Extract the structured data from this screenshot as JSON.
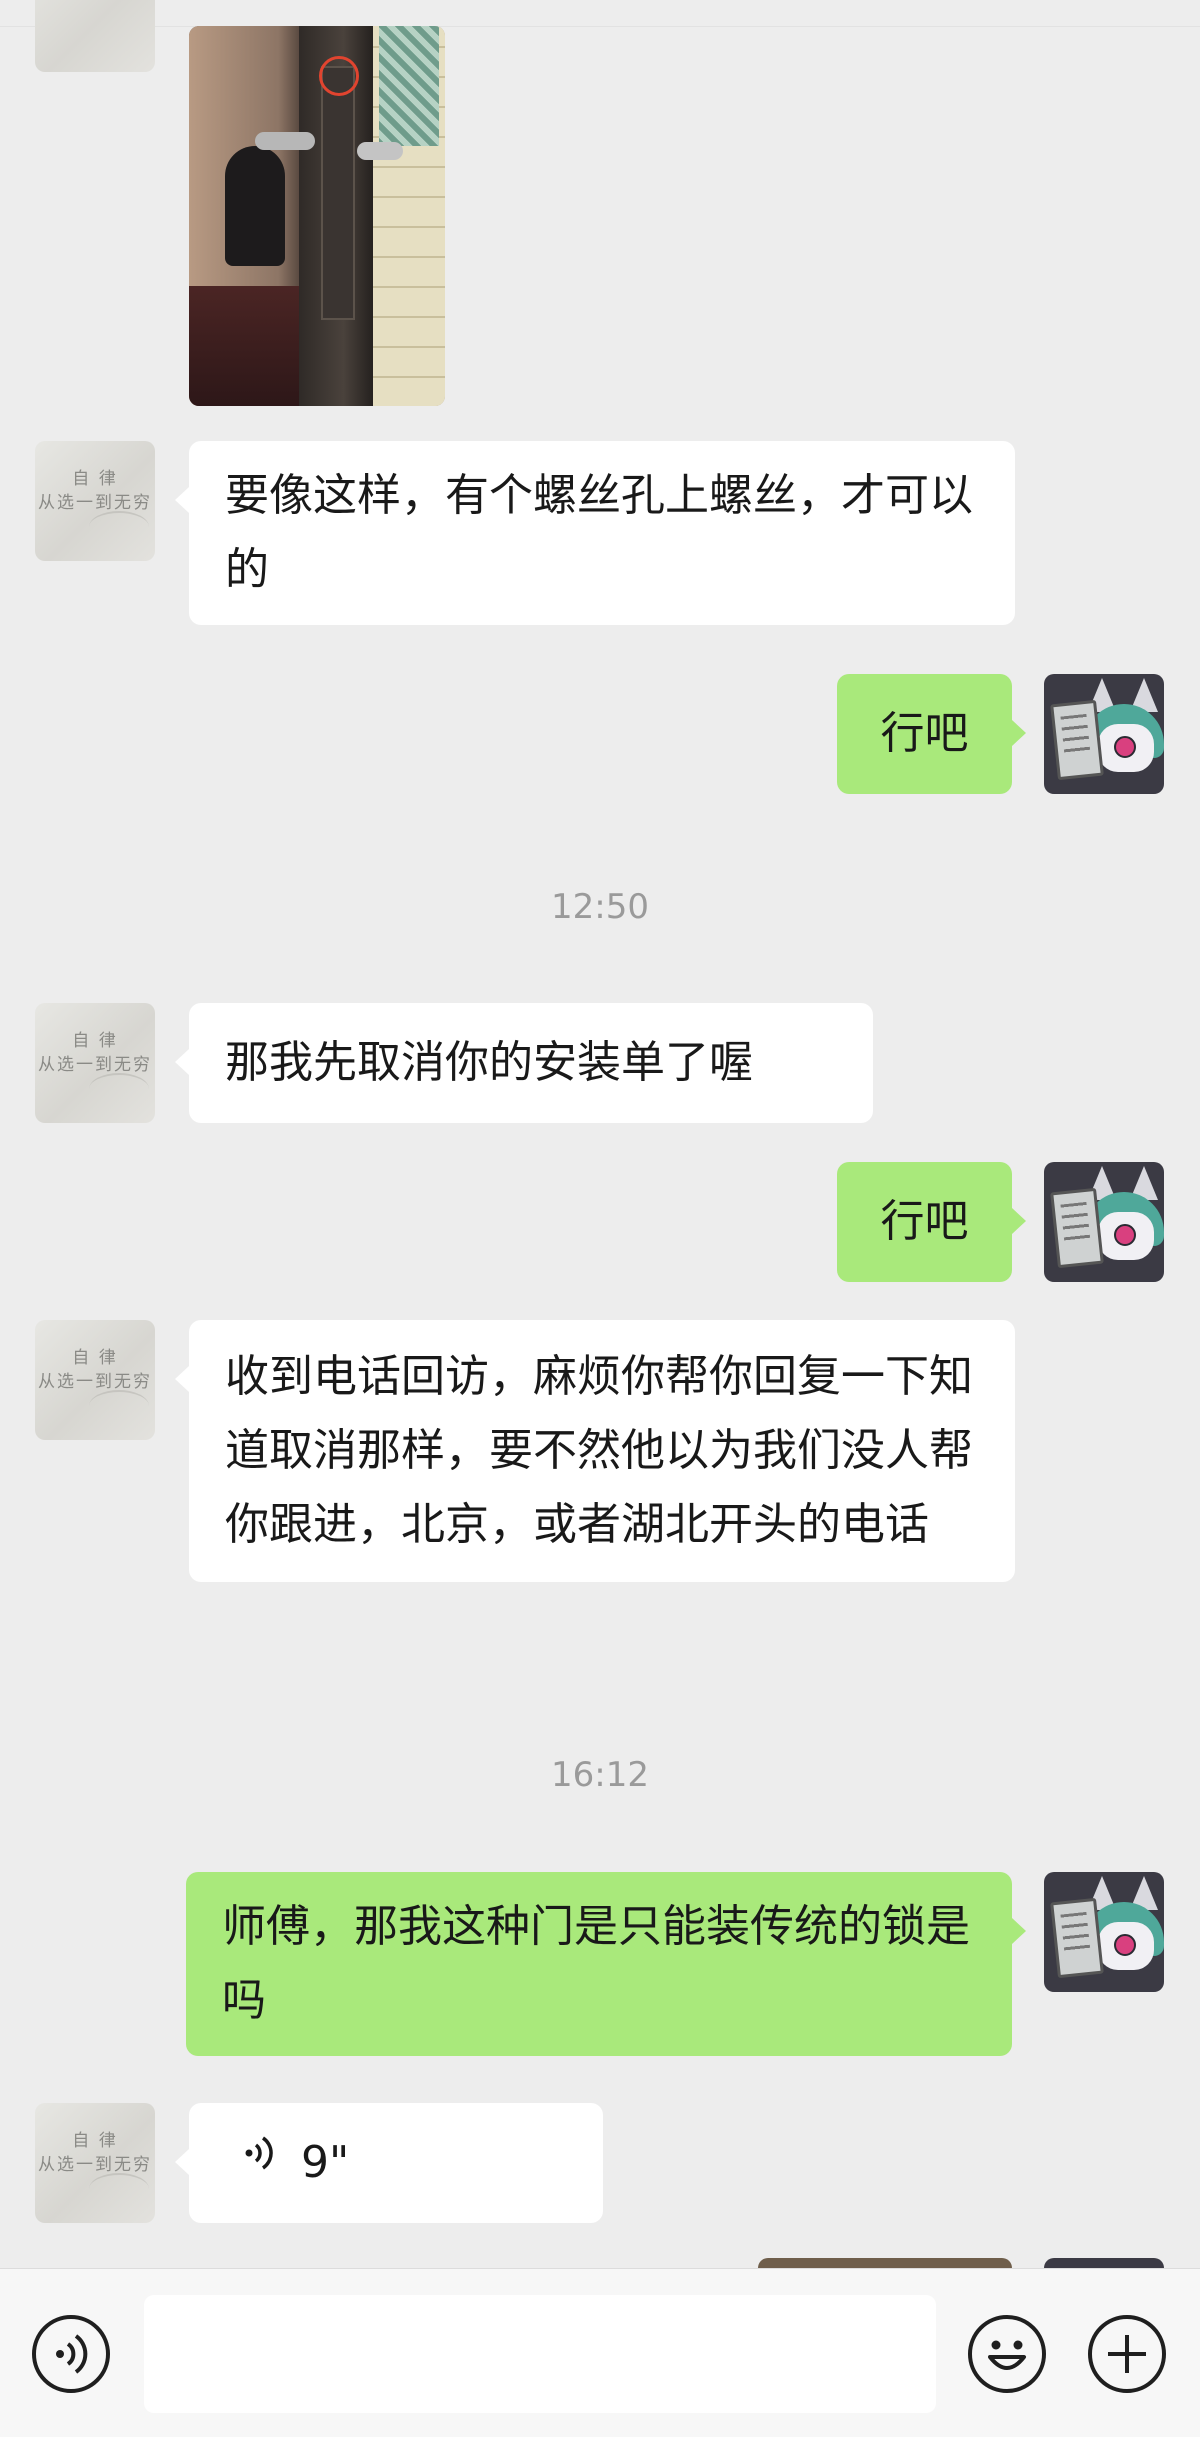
{
  "messages": {
    "m1": {
      "text": "要像这样，有个螺丝孔上螺丝，才可以的"
    },
    "m2": {
      "text": "行吧"
    },
    "t1": {
      "text": "12:50"
    },
    "m3": {
      "text": "那我先取消你的安装单了喔"
    },
    "m4": {
      "text": "行吧"
    },
    "m5": {
      "text": "收到电话回访，麻烦你帮你回复一下知道取消那样，要不然他以为我们没人帮你跟进，北京，或者湖北开头的电话"
    },
    "t2": {
      "text": "16:12"
    },
    "m6": {
      "text": "师傅，那我这种门是只能装传统的锁是吗"
    },
    "m7": {
      "duration": "9\""
    }
  },
  "avatars": {
    "contact_text": "自 律\n从选一到无穷",
    "self_description": "anime-character-avatar"
  },
  "icons": {
    "voice_toggle": "voice-mode-icon",
    "emoji": "emoji-icon",
    "more": "plus-icon",
    "voice_message": "voice-wave-icon"
  },
  "colors": {
    "background": "#ededed",
    "outgoing_bubble": "#a9e97b",
    "incoming_bubble": "#ffffff",
    "timestamp": "#9a9a9a"
  }
}
